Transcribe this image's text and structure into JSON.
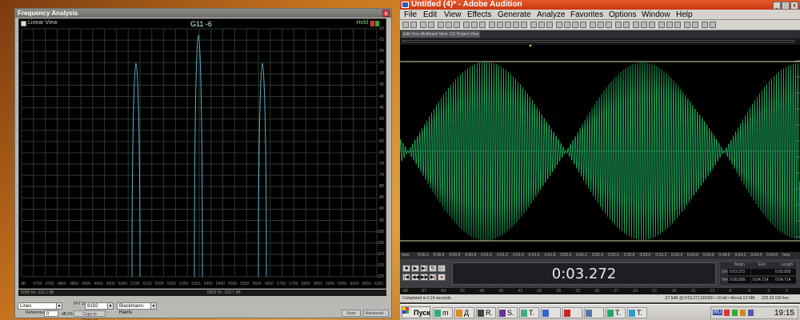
{
  "freq_window": {
    "title": "Frequency Analysis",
    "close": "x",
    "linear_view": "Linear View",
    "graph_label": "G11 -6",
    "hold": "Hold",
    "y_labels": [
      "-10",
      "-15",
      "-20",
      "-25",
      "-30",
      "-35",
      "-40",
      "-45",
      "-50",
      "-55",
      "-60",
      "-65",
      "-70",
      "-75",
      "-80",
      "-85",
      "-90",
      "-95",
      "-100",
      "-105",
      "-110",
      "-115",
      "-120"
    ],
    "x_labels": [
      "dB",
      "4700",
      "4750",
      "4800",
      "4850",
      "4900",
      "4950",
      "5000",
      "5050",
      "5100",
      "5150",
      "5200",
      "5250",
      "5300",
      "5350",
      "5400",
      "5450",
      "5500",
      "5550",
      "5600",
      "5650",
      "5700",
      "5750",
      "5800",
      "5850",
      "5900",
      "5950",
      "6000",
      "6050",
      "6100"
    ],
    "info_left": "5098 Hz  -116.1 dB",
    "info_mid": "5803 Hz  -103.7 dB",
    "display_mode": "Lines",
    "reference_label": "Reference",
    "reference_value": "0",
    "reference_unit": "dB FS",
    "fft_label": "FFT Size",
    "fft_size": "8192",
    "window_func": "Blackmann-Harris",
    "copy_button": "Copy to Clipboard",
    "scan_button": "Scan",
    "advanced_button": "Advanced..."
  },
  "audition": {
    "title": "Untitled (4)* - Adobe Audition",
    "win_buttons": [
      "_",
      "□",
      "x"
    ],
    "menu": [
      "File",
      "Edit",
      "View",
      "Effects",
      "Generate",
      "Analyze",
      "Favorites",
      "Options",
      "Window",
      "Help"
    ],
    "tabs": [
      "Edit View",
      "Multitrack View",
      "CD Project View"
    ],
    "ruler": [
      "hms",
      "0:00.2",
      "0:00.4",
      "0:00.6",
      "0:00.8",
      "0:01.0",
      "0:01.2",
      "0:01.4",
      "0:01.6",
      "0:01.8",
      "0:02.0",
      "0:02.2",
      "0:02.4",
      "0:02.6",
      "0:02.8",
      "0:03.0",
      "0:03.2",
      "0:03.4",
      "0:03.6",
      "0:03.8",
      "0:04.0",
      "0:04.2",
      "0:04.4",
      "0:04.6",
      "hms"
    ],
    "time_display": "0:03.272",
    "selection": {
      "headers": [
        "Begin",
        "End",
        "Length"
      ],
      "sel_label": "Sel",
      "view_label": "View",
      "sel_begin": "0:03.272",
      "sel_end": "",
      "sel_length": "0:00.000",
      "view_begin": "0:00.000",
      "view_end": "0:04.714",
      "view_length": "0:04.714"
    },
    "level_labels": [
      "-dB",
      "-57",
      "-54",
      "-51",
      "-48",
      "-45",
      "-42",
      "-39",
      "-36",
      "-33",
      "-30",
      "-27",
      "-24",
      "-21",
      "-18",
      "-15",
      "-12",
      "-9",
      "-6",
      "-3",
      "0"
    ],
    "status": {
      "completed": "Completed in 0.14 seconds",
      "level": "-27.5dB @ 0:03.271",
      "format": "192000 • 16-bit • Mono",
      "size": "1.52 MB",
      "free": "220.29 GB free"
    },
    "wave_color": "#1fae60"
  },
  "taskbar": {
    "start": "Пуск",
    "items": [
      "m",
      "Д",
      "R.",
      "S.",
      "T.",
      "",
      "",
      "",
      "T.",
      "T."
    ],
    "lang": "RU",
    "clock": "19:15"
  }
}
